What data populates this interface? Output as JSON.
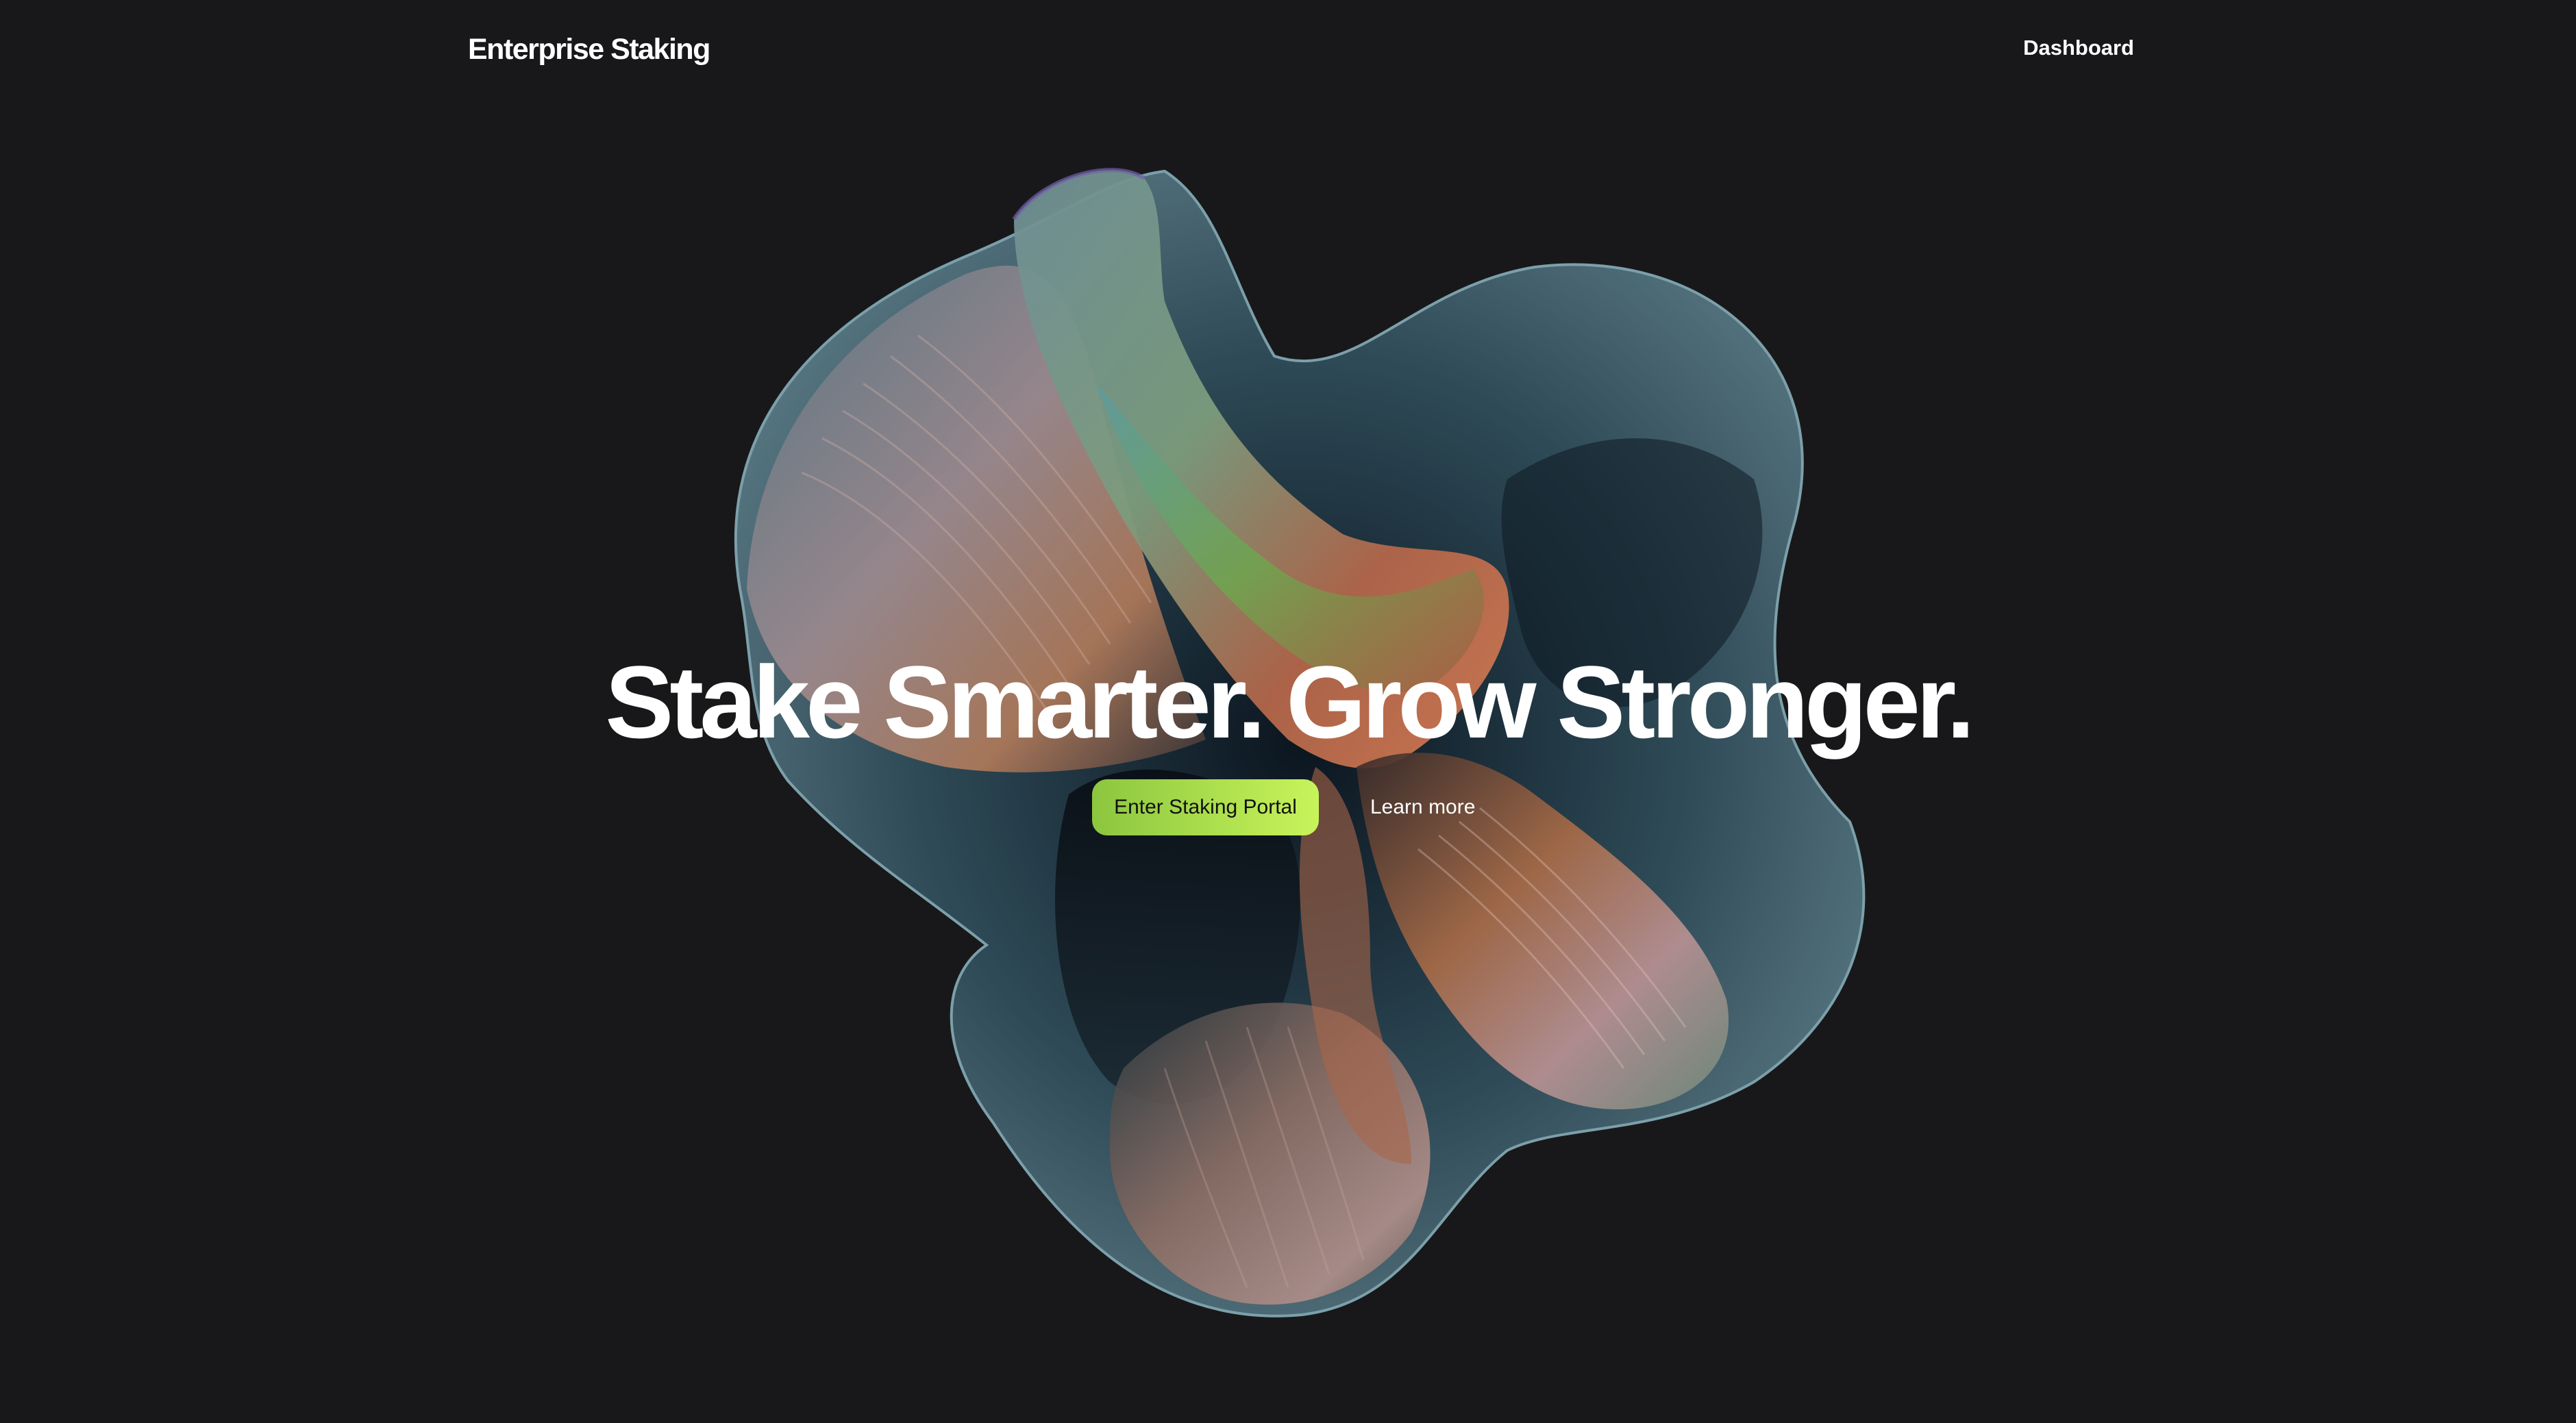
{
  "header": {
    "brand": "Enterprise Staking",
    "nav_dashboard": "Dashboard"
  },
  "hero": {
    "headline": "Stake Smarter. Grow Stronger.",
    "primary_cta": "Enter Staking Portal",
    "secondary_cta": "Learn more"
  },
  "colors": {
    "background": "#18181a",
    "accent_start": "#8cc63f",
    "accent_end": "#c8f45a",
    "text": "#ffffff"
  }
}
